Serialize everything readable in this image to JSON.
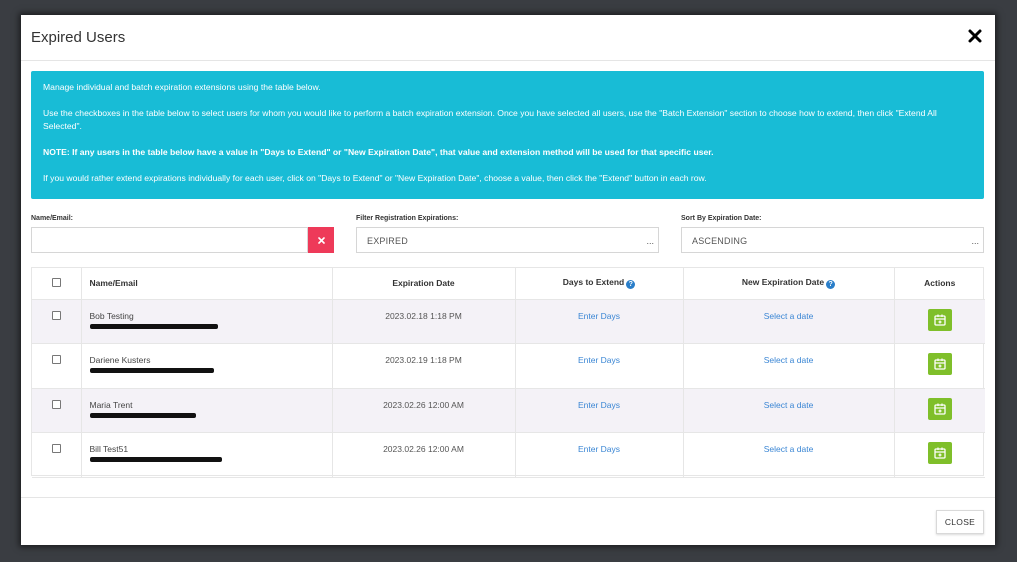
{
  "modal": {
    "title": "Expired Users"
  },
  "info": {
    "line1": "Manage individual and batch expiration extensions using the table below.",
    "line2": "Use the checkboxes in the table below to select users for whom you would like to perform a batch expiration extension. Once you have selected all users, use the \"Batch Extension\" section to choose how to extend, then click \"Extend All Selected\".",
    "note": "NOTE: If any users in the table below have a value in \"Days to Extend\" or \"New Expiration Date\", that value and extension method will be used for that specific user.",
    "line4": "If you would rather extend expirations individually for each user, click on \"Days to Extend\" or \"New Expiration Date\", choose a value, then click the \"Extend\" button in each row."
  },
  "filters": {
    "name_label": "Name/Email:",
    "name_value": "",
    "registration_label": "Filter Registration Expirations:",
    "registration_value": "EXPIRED",
    "sort_label": "Sort By Expiration Date:",
    "sort_value": "ASCENDING",
    "dots": "..."
  },
  "table": {
    "headers": {
      "name": "Name/Email",
      "expiration": "Expiration Date",
      "days": "Days to Extend",
      "new_date": "New Expiration Date",
      "actions": "Actions"
    },
    "rows": [
      {
        "name": "Bob Testing",
        "expiration": "2023.02.18 1:18 PM",
        "days": "Enter Days",
        "new_date": "Select a date"
      },
      {
        "name": "Dariene Kusters",
        "expiration": "2023.02.19 1:18 PM",
        "days": "Enter Days",
        "new_date": "Select a date"
      },
      {
        "name": "Maria Trent",
        "expiration": "2023.02.26 12:00 AM",
        "days": "Enter Days",
        "new_date": "Select a date"
      },
      {
        "name": "Bill Test51",
        "expiration": "2023.02.26 12:00 AM",
        "days": "Enter Days",
        "new_date": "Select a date"
      }
    ]
  },
  "footer": {
    "close_label": "CLOSE"
  },
  "colors": {
    "info_bg": "#18bcd6",
    "clear_button": "#ee3a59",
    "action_button": "#7fbf2a",
    "link": "#3a86d4"
  },
  "icons": {
    "close": "close-icon",
    "clear": "clear-x-icon",
    "help": "question-circle-icon",
    "action": "calendar-plus-icon"
  }
}
